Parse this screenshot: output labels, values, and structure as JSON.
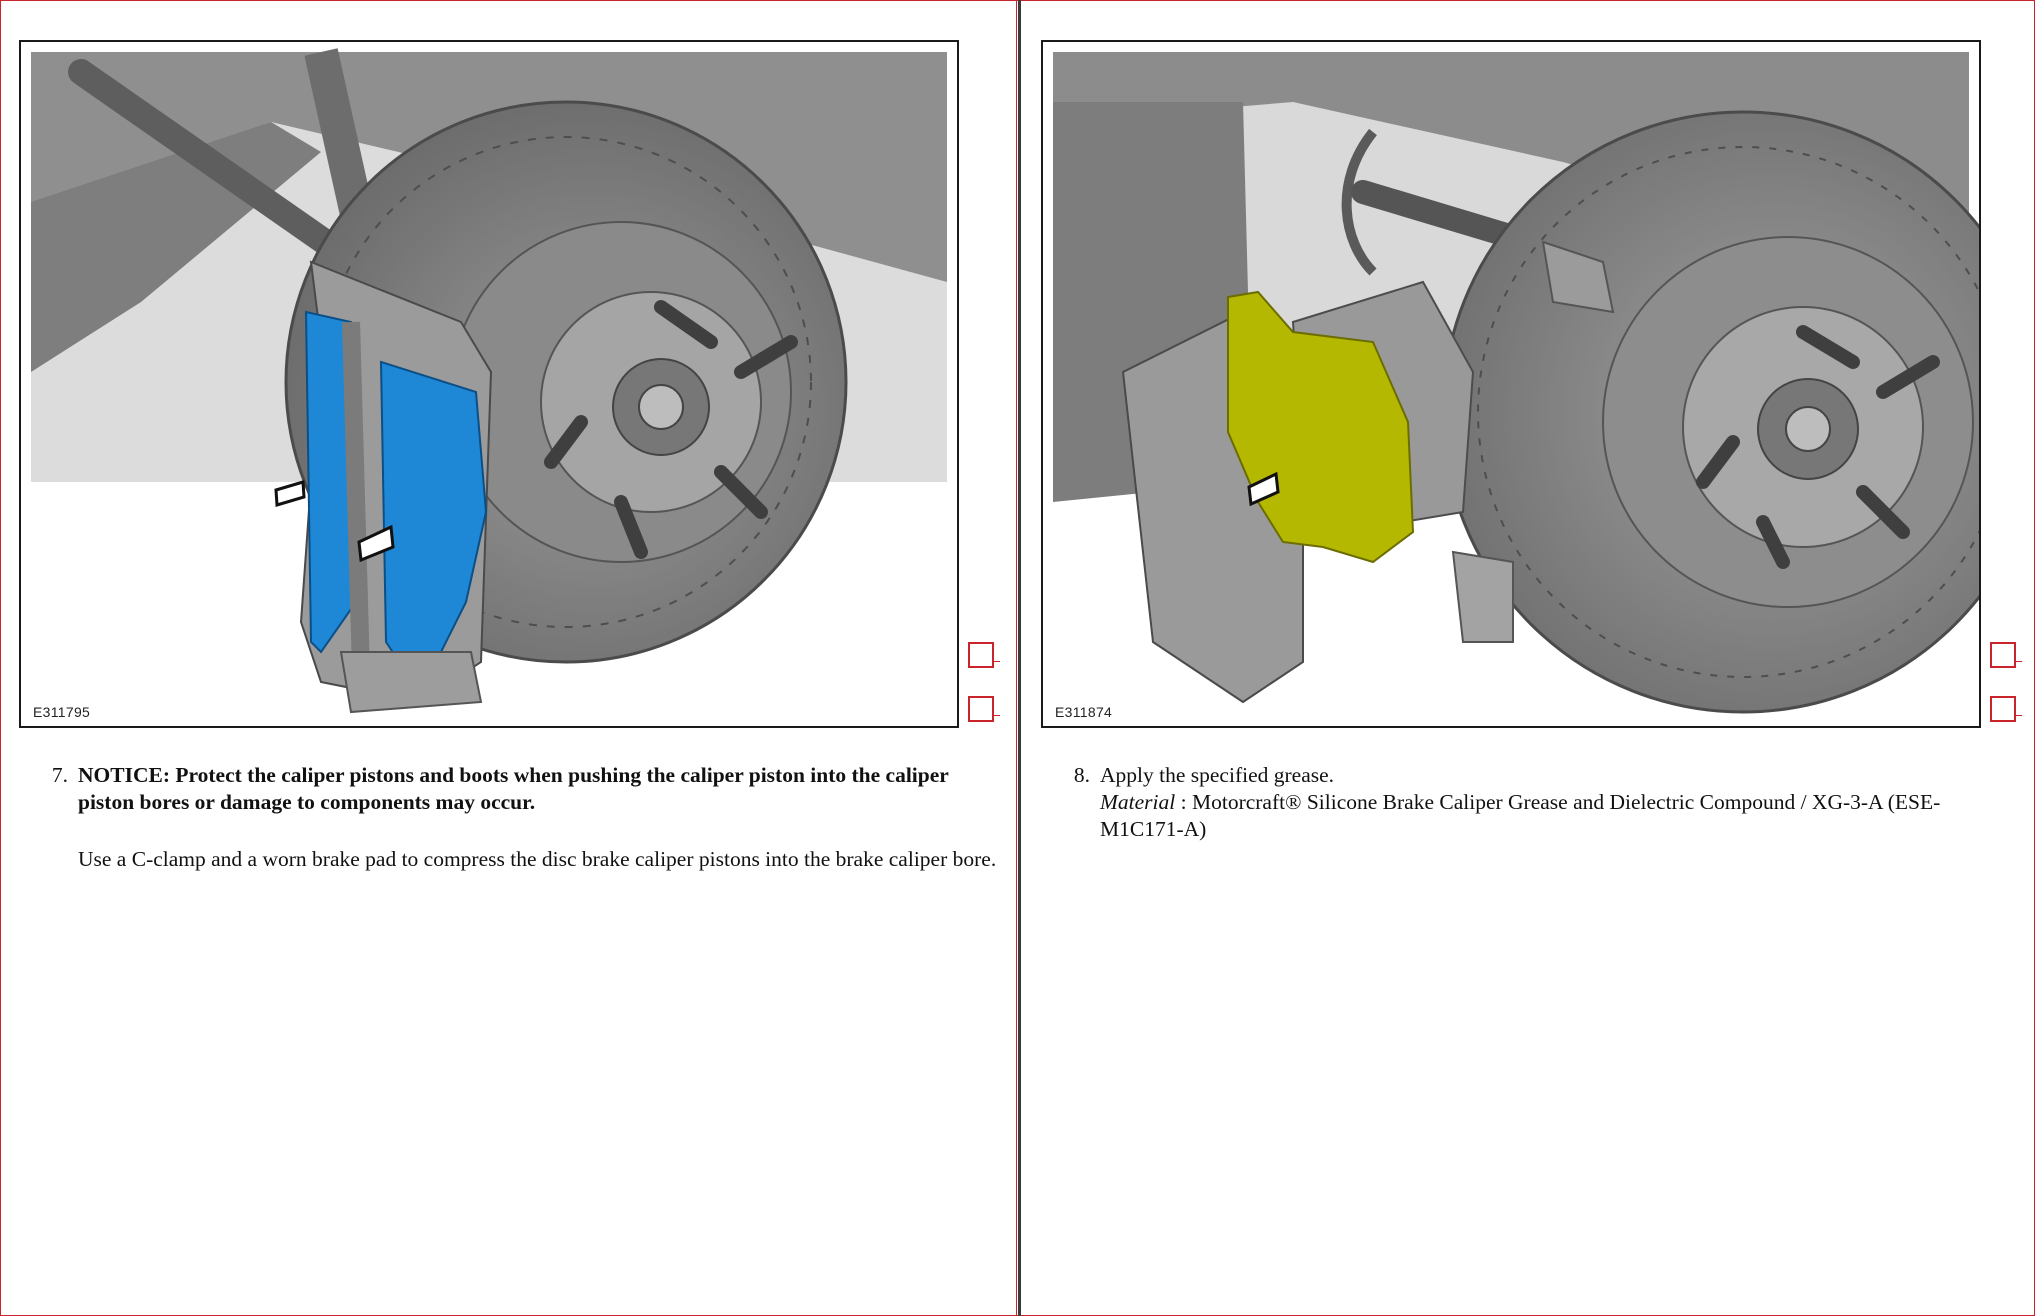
{
  "left": {
    "figure_id": "E311795",
    "step_number": "7.",
    "notice": "NOTICE: Protect the caliper pistons and boots when pushing the caliper piston into the caliper piston bores or damage to components may occur.",
    "instruction": "Use a C-clamp and a worn brake pad to compress the disc brake caliper pistons into the brake caliper bore."
  },
  "right": {
    "figure_id": "E311874",
    "step_number": "8.",
    "instruction": "Apply the specified grease.",
    "material_label": "Material",
    "material_separator": " : ",
    "material_value": "Motorcraft® Silicone Brake Caliper Grease and Dielectric Compound / XG-3-A (ESE-M1C171-A)"
  },
  "colors": {
    "frame_red": "#c9242b",
    "brake_pad_blue": "#1e88d6",
    "brake_pad_yellow": "#b5b800"
  }
}
